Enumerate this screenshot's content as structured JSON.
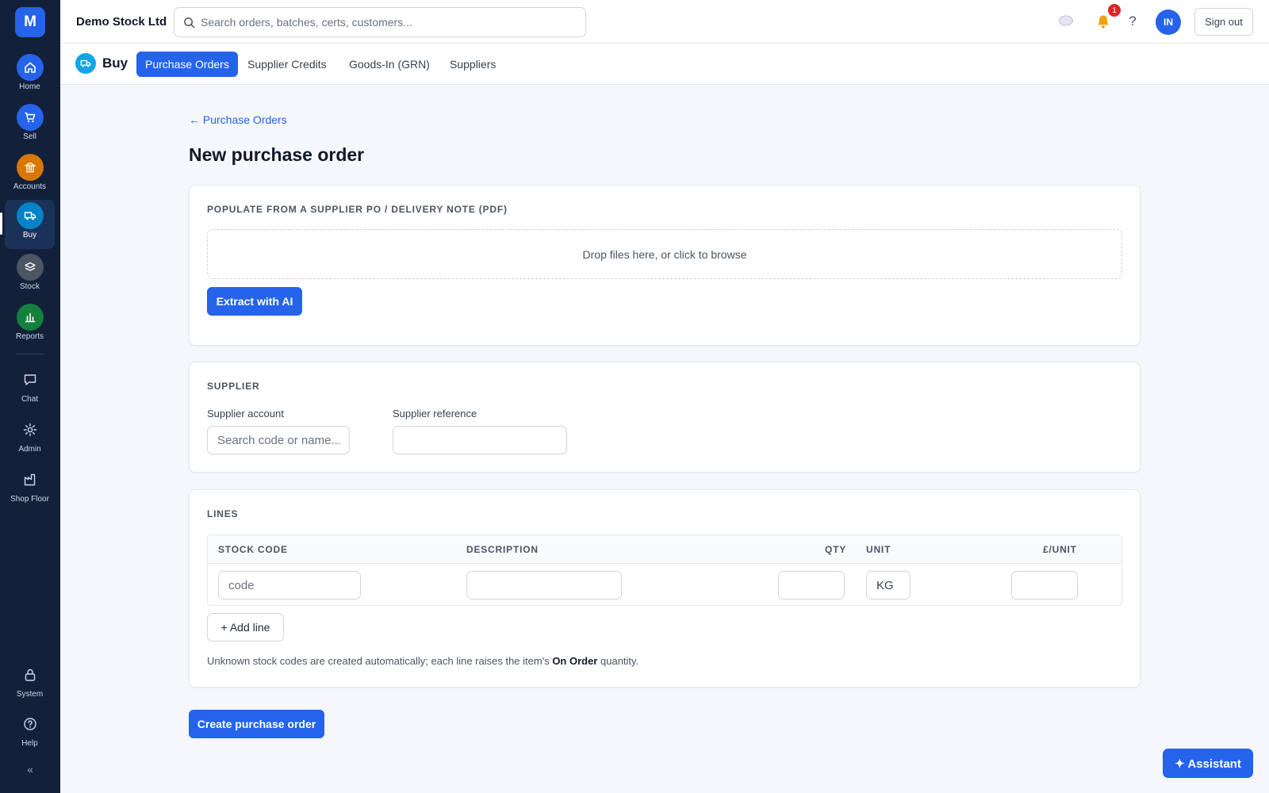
{
  "rail": {
    "logo": "M",
    "items": [
      {
        "label": "Home",
        "icon": "home-icon",
        "color": "#2563eb"
      },
      {
        "label": "Sell",
        "icon": "cart-icon",
        "color": "#2563eb"
      },
      {
        "label": "Accounts",
        "icon": "bank-icon",
        "color": "#d97706"
      },
      {
        "label": "Buy",
        "icon": "truck-icon",
        "color": "#0284c7"
      },
      {
        "label": "Stock",
        "icon": "layers-icon",
        "color": "#4b5563"
      },
      {
        "label": "Reports",
        "icon": "bar-chart-icon",
        "color": "#15803d"
      }
    ],
    "tools": [
      {
        "label": "Chat",
        "icon": "chat-icon"
      },
      {
        "label": "Admin",
        "icon": "gear-icon"
      },
      {
        "label": "Shop Floor",
        "icon": "factory-icon"
      }
    ],
    "bottom": [
      {
        "label": "System",
        "icon": "lock-icon"
      },
      {
        "label": "Help",
        "icon": "help-circle-icon"
      }
    ],
    "collapse": "«"
  },
  "topbar": {
    "company": "Demo Stock Ltd",
    "search_placeholder": "Search orders, batches, certs, customers...",
    "notification_count": "1",
    "help": "?",
    "avatar": "IN",
    "signout": "Sign out"
  },
  "subnav": {
    "module": "Buy",
    "tabs": [
      "Purchase Orders",
      "Supplier Credits",
      "Goods-In (GRN)",
      "Suppliers"
    ],
    "active_tab": 0
  },
  "page": {
    "back": "← Purchase Orders",
    "title": "New purchase order"
  },
  "populate": {
    "title": "POPULATE FROM A SUPPLIER PO / DELIVERY NOTE (PDF)",
    "dropzone": "Drop files here, or click to browse",
    "extract_button": "Extract with AI"
  },
  "supplier": {
    "title": "SUPPLIER",
    "account_label": "Supplier account",
    "account_placeholder": "Search code or name...",
    "reference_label": "Supplier reference",
    "reference_value": ""
  },
  "lines": {
    "title": "LINES",
    "columns": [
      "STOCK CODE",
      "DESCRIPTION",
      "QTY",
      "UNIT",
      "£/UNIT"
    ],
    "row": {
      "code_placeholder": "code",
      "description": "",
      "qty": "",
      "unit": "KG",
      "price": ""
    },
    "add_line": "+ Add line",
    "hint_prefix": "Unknown stock codes are created automatically; each line raises the item's ",
    "hint_bold": "On Order",
    "hint_suffix": " quantity."
  },
  "create_button": "Create purchase order",
  "assistant_button": "✦ Assistant",
  "colors": {
    "accent": "#2563eb",
    "rail_bg": "#13203a",
    "badge": "#dc2626"
  }
}
